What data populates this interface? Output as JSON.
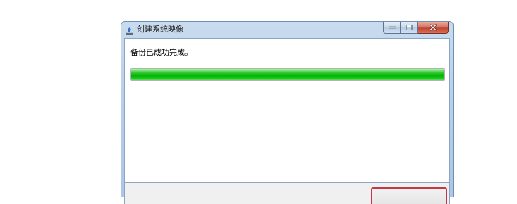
{
  "window": {
    "title": "创建系统映像",
    "app_icon": "backup-icon",
    "caption_buttons": {
      "minimize_icon": "minimize-icon",
      "maximize_icon": "maximize-icon",
      "close_icon": "close-icon"
    }
  },
  "main": {
    "status_text": "备份已成功完成。",
    "progress": {
      "percent": 100,
      "color": "#06b006"
    }
  },
  "footer": {
    "close_button_label": "",
    "close_button_border_color": "#c2394a"
  }
}
